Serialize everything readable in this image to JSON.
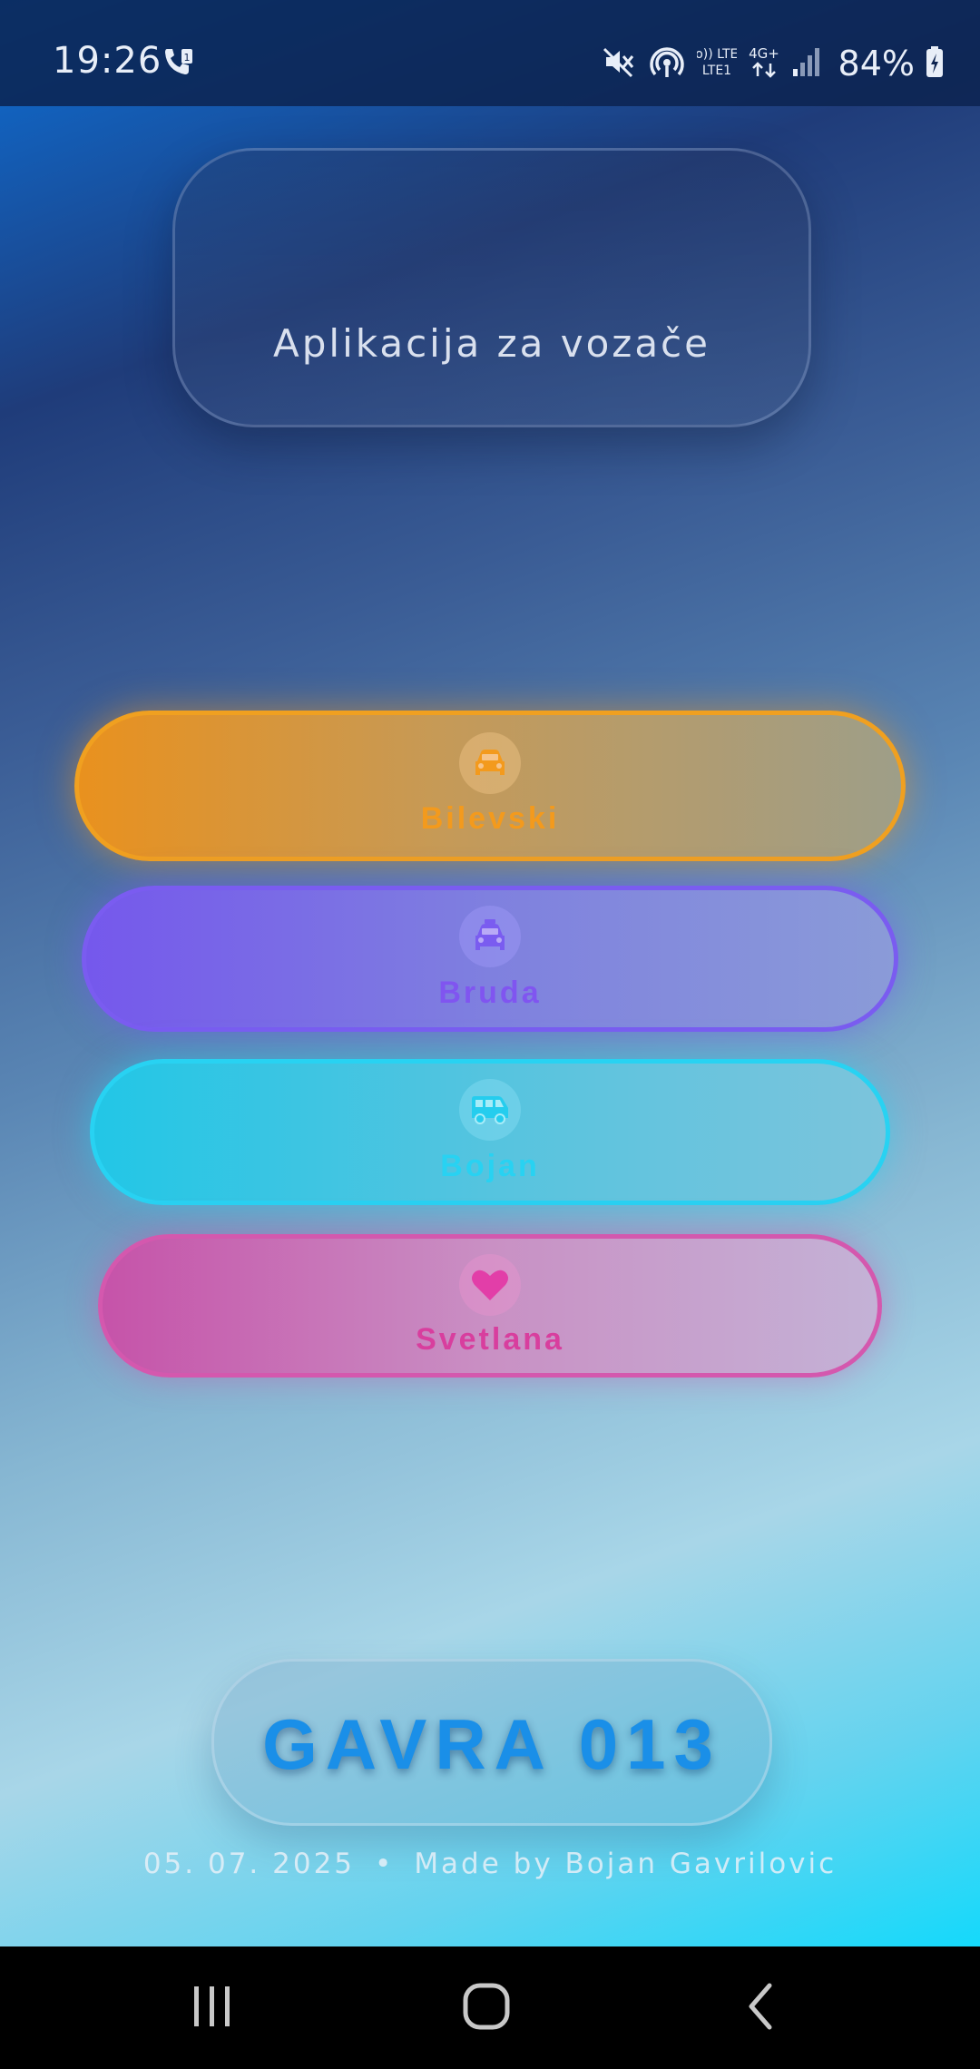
{
  "status_bar": {
    "time": "19:26",
    "battery_percent": "84%",
    "network_labels": [
      "Vo)) LTE1",
      "4G+"
    ],
    "icons": [
      "call-sim-icon",
      "mute-icon",
      "hotspot-icon",
      "volte-icon",
      "4g-data-icon",
      "signal-icon",
      "battery-charging-icon"
    ]
  },
  "header": {
    "subtitle": "Aplikacija za vozače"
  },
  "drivers": [
    {
      "name": "Bilevski",
      "icon": "car-icon",
      "color": "#f0a020"
    },
    {
      "name": "Bruda",
      "icon": "taxi-icon",
      "color": "#7a5cf0"
    },
    {
      "name": "Bojan",
      "icon": "van-icon",
      "color": "#28d2f2"
    },
    {
      "name": "Svetlana",
      "icon": "heart-icon",
      "color": "#e040a8"
    }
  ],
  "brand": {
    "title": "GAVRA 013"
  },
  "footer": {
    "date": "05. 07. 2025",
    "separator": "•",
    "credit": "Made by Bojan Gavrilovic"
  },
  "nav_bar": {
    "icons": [
      "recent-apps-icon",
      "home-icon",
      "back-icon"
    ]
  }
}
